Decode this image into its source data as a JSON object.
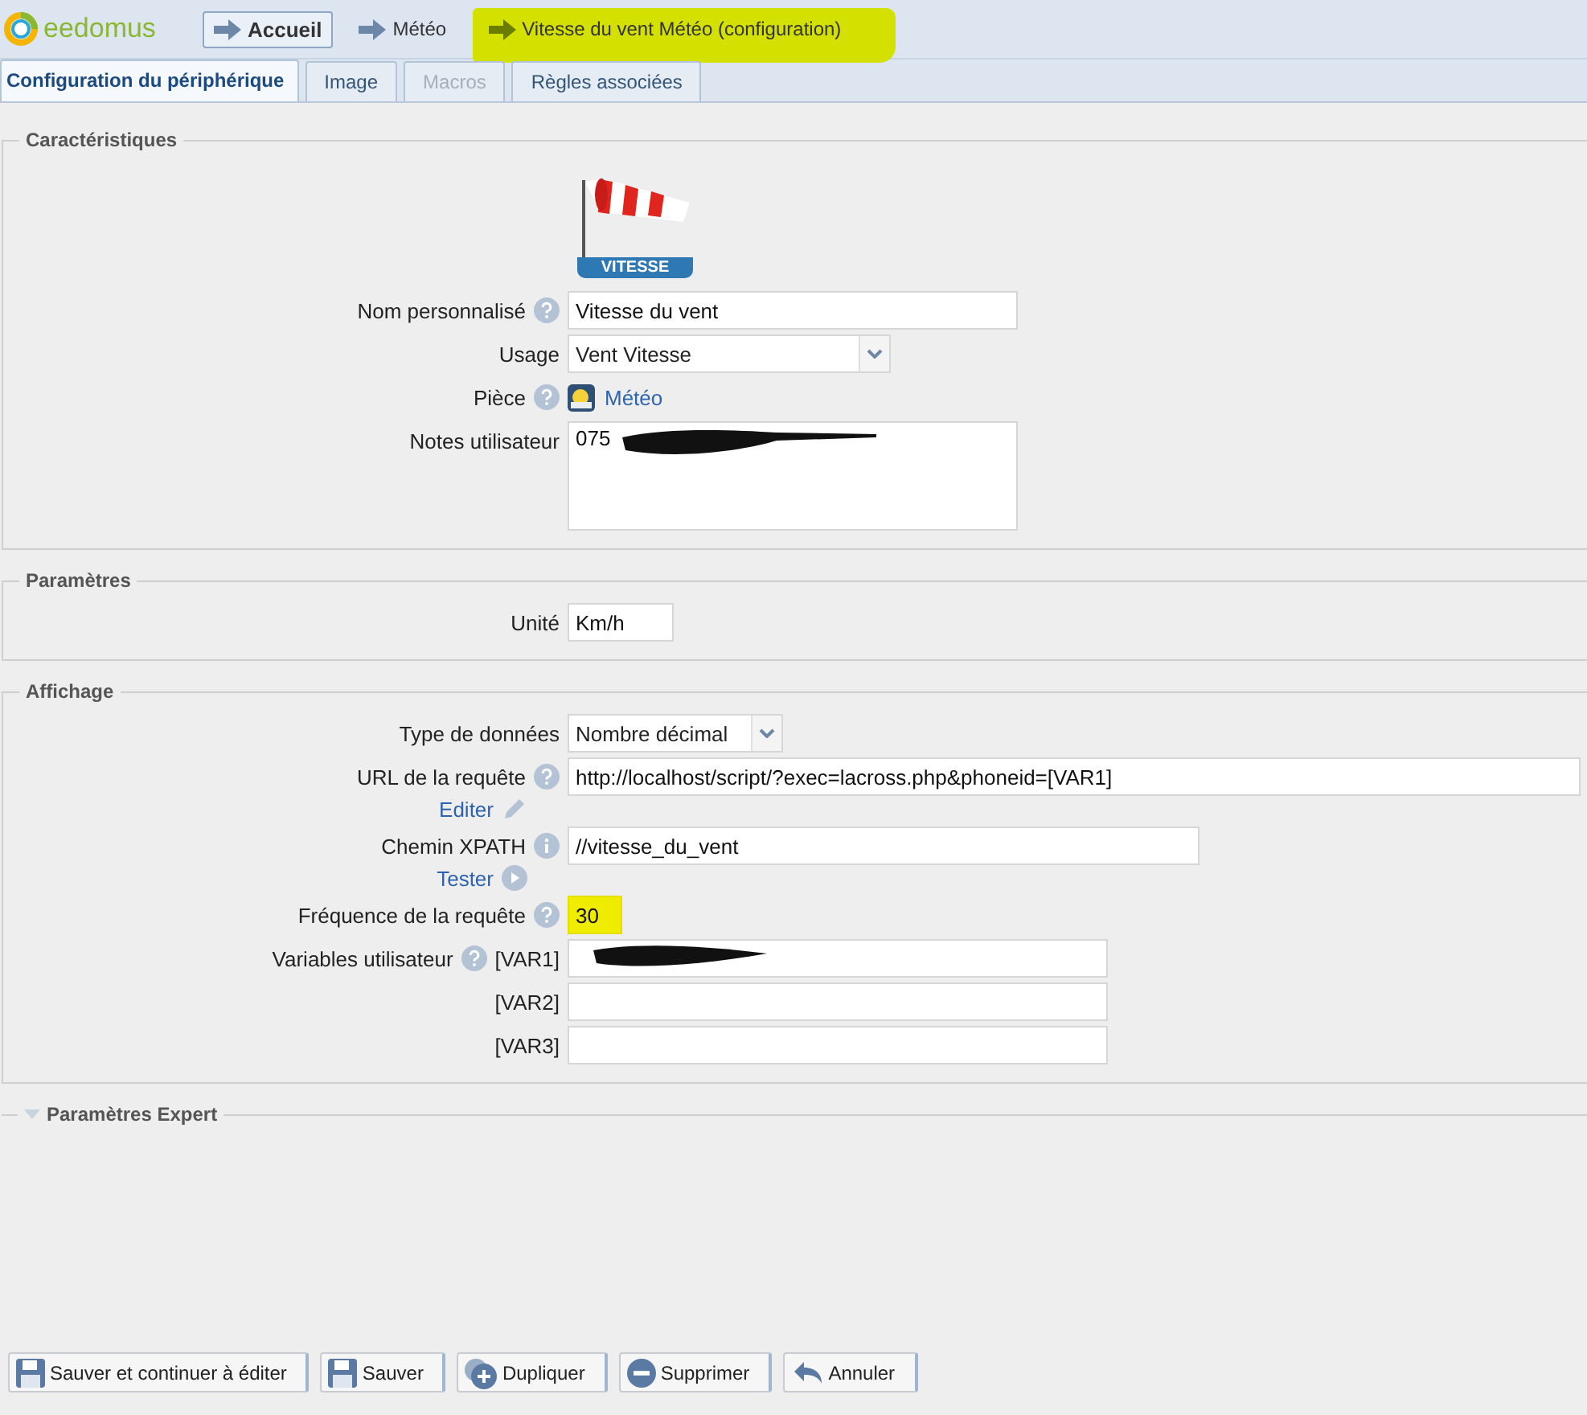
{
  "header": {
    "logo": "eedomus",
    "breadcrumb": [
      {
        "label": "Accueil",
        "kind": "button",
        "highlighted": false
      },
      {
        "label": "Météo",
        "kind": "link",
        "highlighted": false
      },
      {
        "label": "Vitesse du vent Météo (configuration)",
        "kind": "link",
        "highlighted": true
      }
    ]
  },
  "tabs": [
    {
      "label": "Configuration du périphérique",
      "selected": true,
      "disabled": false
    },
    {
      "label": "Image",
      "selected": false,
      "disabled": false
    },
    {
      "label": "Macros",
      "selected": false,
      "disabled": true
    },
    {
      "label": "Règles associées",
      "selected": false,
      "disabled": false
    }
  ],
  "sections": [
    {
      "title": "Caractéristiques",
      "rows": [
        {
          "kind": "image",
          "caption": "VITESSE"
        },
        {
          "kind": "text",
          "label": "Nom personnalisé",
          "help": {
            "kind": "question"
          },
          "value": "Vitesse du vent",
          "highlighted": false
        },
        {
          "kind": "select",
          "label": "Usage",
          "value": "Vent Vitesse"
        },
        {
          "kind": "link",
          "label": "Pièce",
          "help": {
            "kind": "question"
          },
          "value": "Météo"
        },
        {
          "kind": "textarea",
          "label": "Notes utilisateur",
          "value": "075",
          "redacted": true
        }
      ]
    },
    {
      "title": "Paramètres",
      "rows": [
        {
          "kind": "text",
          "label": "Unité",
          "value": "Km/h",
          "highlighted": false
        }
      ]
    },
    {
      "title": "Affichage",
      "rows": [
        {
          "kind": "select",
          "label": "Type de données",
          "value": "Nombre décimal"
        },
        {
          "kind": "text",
          "label": "URL de la requête",
          "help": {
            "kind": "question"
          },
          "value": "http://localhost/script/?exec=lacross.php&phoneid=[VAR1]",
          "highlighted": false,
          "action": {
            "label": "Editer",
            "kind": "edit"
          }
        },
        {
          "kind": "text",
          "label": "Chemin XPATH",
          "help": {
            "kind": "info"
          },
          "value": "//vitesse_du_vent",
          "highlighted": false,
          "action": {
            "label": "Tester",
            "kind": "test"
          }
        },
        {
          "kind": "text",
          "label": "Fréquence de la requête",
          "help": {
            "kind": "question"
          },
          "value": "30",
          "highlighted": true
        },
        {
          "kind": "text",
          "label": "Variables utilisateur",
          "help": {
            "kind": "question"
          },
          "prefix": "[VAR1]",
          "highlighted": false,
          "redacted": true
        },
        {
          "kind": "text",
          "prefix": "[VAR2]",
          "highlighted": false
        },
        {
          "kind": "text",
          "prefix": "[VAR3]",
          "highlighted": false
        }
      ]
    },
    {
      "title": "Paramètres Expert",
      "expanded": false
    }
  ],
  "buttons": [
    {
      "label": "Sauver et continuer à éditer",
      "kind": "save"
    },
    {
      "label": "Sauver",
      "kind": "save"
    },
    {
      "label": "Dupliquer",
      "kind": "duplicate"
    },
    {
      "label": "Supprimer",
      "kind": "delete"
    },
    {
      "label": "Annuler",
      "kind": "undo"
    }
  ]
}
